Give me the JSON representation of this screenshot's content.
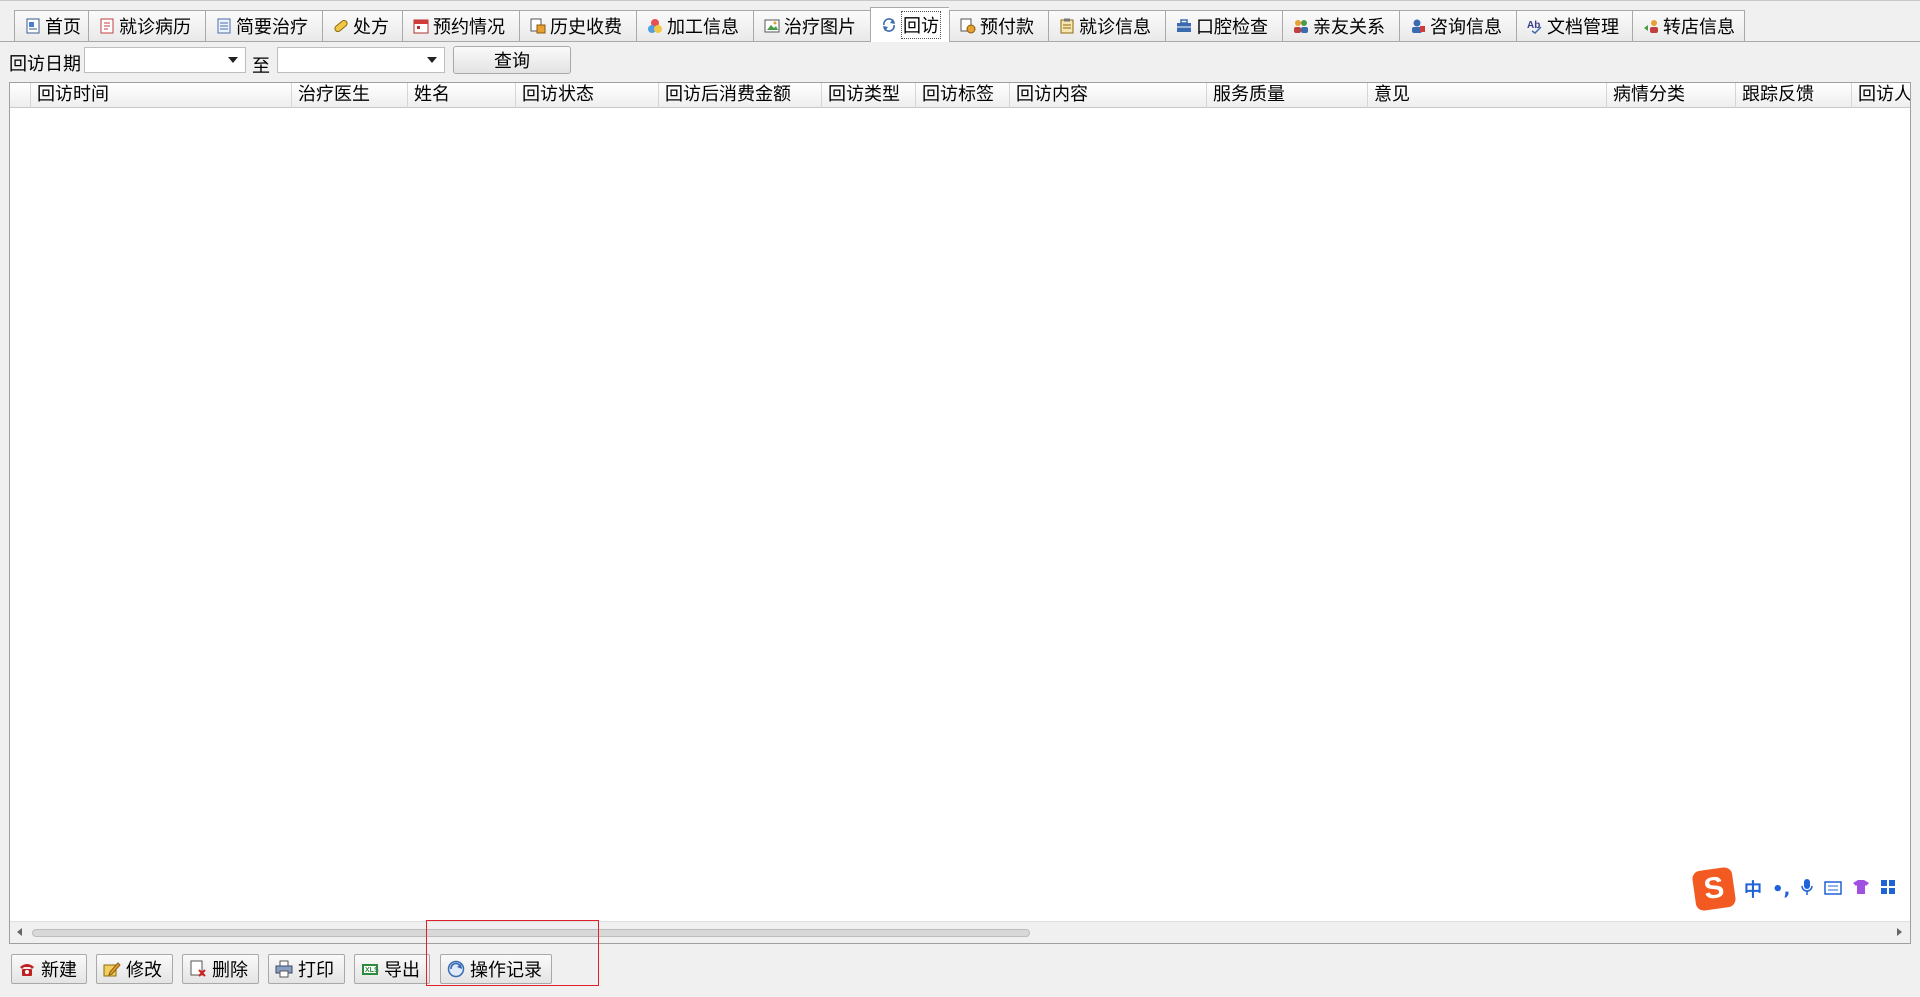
{
  "tabs": [
    {
      "label": "首页",
      "icon": "home-page-icon"
    },
    {
      "label": "就诊病历",
      "icon": "medical-record-icon"
    },
    {
      "label": "简要治疗",
      "icon": "document-icon"
    },
    {
      "label": "处方",
      "icon": "pill-icon"
    },
    {
      "label": "预约情况",
      "icon": "calendar-icon"
    },
    {
      "label": "历史收费",
      "icon": "fee-history-icon"
    },
    {
      "label": "加工信息",
      "icon": "processing-icon"
    },
    {
      "label": "治疗图片",
      "icon": "picture-icon"
    },
    {
      "label": "回访",
      "icon": "refresh-icon",
      "active": true
    },
    {
      "label": "预付款",
      "icon": "prepayment-icon"
    },
    {
      "label": "就诊信息",
      "icon": "clipboard-icon"
    },
    {
      "label": "口腔检查",
      "icon": "toolbox-icon"
    },
    {
      "label": "亲友关系",
      "icon": "people-icon"
    },
    {
      "label": "咨询信息",
      "icon": "consult-icon"
    },
    {
      "label": "文档管理",
      "icon": "spellcheck-icon"
    },
    {
      "label": "转店信息",
      "icon": "transfer-icon"
    }
  ],
  "filter": {
    "date_label": "回访日期",
    "to_label": "至",
    "start_date": "",
    "end_date": "",
    "query_button": "查询"
  },
  "grid": {
    "columns": [
      "回访时间",
      "治疗医生",
      "姓名",
      "回访状态",
      "回访后消费金额",
      "回访类型",
      "回访标签",
      "回访内容",
      "服务质量",
      "意见",
      "病情分类",
      "跟踪反馈",
      "回访人"
    ],
    "rows": []
  },
  "toolbar": {
    "new": "新建",
    "edit": "修改",
    "delete": "删除",
    "print": "打印",
    "export": "导出",
    "log": "操作记录"
  },
  "ime": {
    "logo": "S",
    "mode": "中",
    "punct": "•,"
  },
  "colors": {
    "highlight": "#e0202a",
    "ime_brand": "#f25a22",
    "ime_icons": "#1f63d8"
  }
}
